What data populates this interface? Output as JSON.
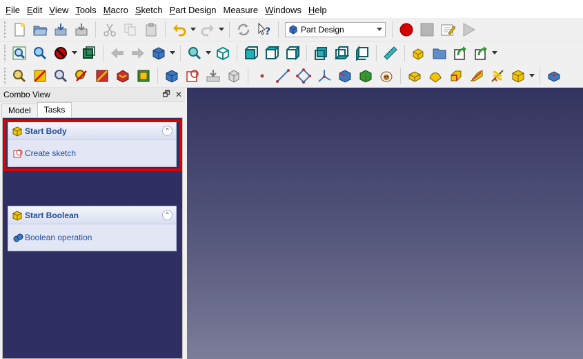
{
  "menubar": {
    "items": [
      {
        "u": "F",
        "rest": "ile"
      },
      {
        "u": "E",
        "rest": "dit"
      },
      {
        "u": "V",
        "rest": "iew"
      },
      {
        "u": "T",
        "rest": "ools"
      },
      {
        "u": "M",
        "rest": "acro"
      },
      {
        "u": "S",
        "rest": "ketch"
      },
      {
        "u": "P",
        "rest": "art Design"
      },
      {
        "u": "",
        "rest": "Measure"
      },
      {
        "u": "W",
        "rest": "indows"
      },
      {
        "u": "H",
        "rest": "elp"
      }
    ]
  },
  "workbench_selector": {
    "label": "Part Design",
    "icon": "part-design-icon"
  },
  "combo_view": {
    "title": "Combo View",
    "float_button": "🗗",
    "close_button": "✕",
    "tabs": [
      "Model",
      "Tasks"
    ],
    "active_tab": "Tasks"
  },
  "tasks": [
    {
      "title": "Start Body",
      "action": "Create sketch",
      "action_icon": "sketch-icon"
    },
    {
      "title": "Start Boolean",
      "action": "Boolean operation",
      "action_icon": "boolean-icon"
    }
  ],
  "colors": {
    "highlight": "#e00000",
    "task_link": "#1f4c98",
    "view_top": "#33335f",
    "view_bottom": "#7c7d99"
  }
}
